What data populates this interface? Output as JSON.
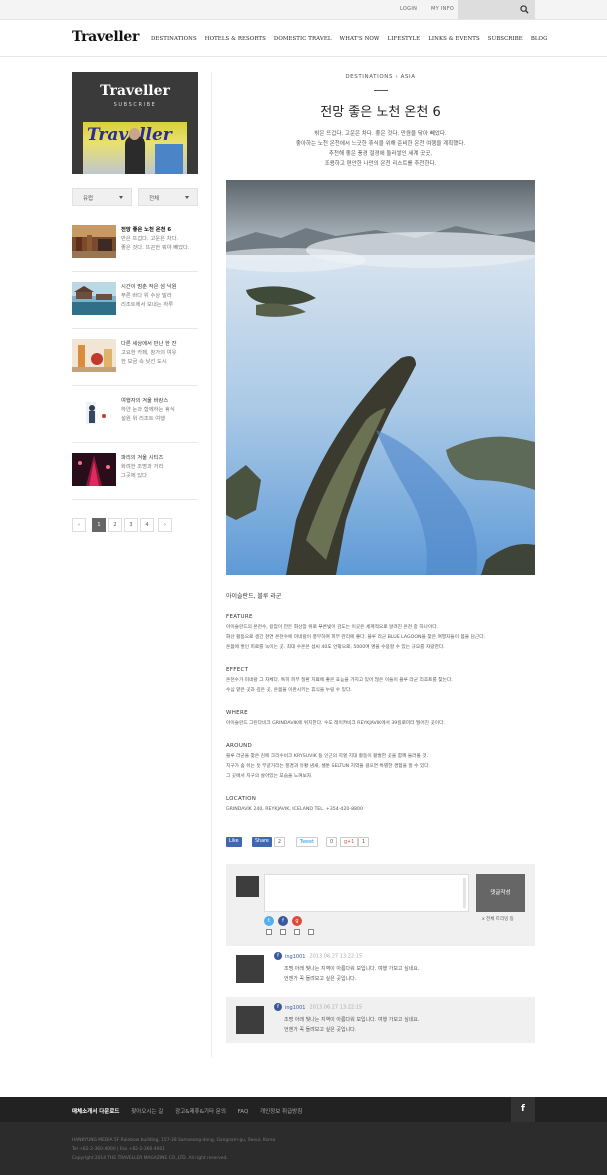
{
  "topbar": {
    "links": [
      "LOGIN",
      "MY INFO"
    ],
    "search_placeholder": ""
  },
  "header": {
    "logo": "Traveller",
    "nav": [
      "DESTINATIONS",
      "HOTELS & RESORTS",
      "DOMESTIC TRAVEL",
      "WHAT'S NOW",
      "LIFESTYLE",
      "LINKS & EVENTS",
      "SUBSCRIBE",
      "BLOG"
    ]
  },
  "sidebar": {
    "subscribe_title": "Traveller",
    "subscribe_sub": "SUBSCRIBE",
    "cover_title": "Traveller",
    "filters": [
      "유럽",
      "전체"
    ],
    "items": [
      {
        "title": "전망 좋은 노천 온천 6",
        "lines": [
          "반은 뜨겁다. 고운은 차다.",
          "좋은 것다. 뜨끈한 뭐야 빼었다."
        ]
      },
      {
        "title": "시간이 멈춘 작은 섬 낙원",
        "lines": [
          "푸른 바다 위 수상 빌라",
          "리조트에서 보내는 하루"
        ]
      },
      {
        "title": "다른 세상에서 만난 한 잔",
        "lines": [
          "고요한 카페, 창가의 여유",
          "한 모금 속 낯선 도시"
        ]
      },
      {
        "title": "여행자의 겨울 바캉스",
        "lines": [
          "하얀 눈과 함께하는 휴식",
          "설원 위 리조트 여행"
        ]
      },
      {
        "title": "파리의 겨울 시티즈",
        "lines": [
          "화려한 조명과 거리",
          "그곳에 있다"
        ]
      }
    ],
    "pages": [
      "‹",
      "1",
      "2",
      "3",
      "4",
      "›"
    ]
  },
  "article": {
    "category": "DESTINATIONS › ASIA",
    "title": "전망 좋은 노천 온천 6",
    "lead": [
      "밖은 뜨겁다. 고운은 차다. 좋은 것다. 만큼을 닦아 빼었다.",
      "좋아하는 노천 온천에서 느긋한 휴식을 위해 준비한 온천 여행을 계획했다.",
      "추천해 좋은 풍경 절경에 둘러쌓인 세계 곳곳,",
      "조용하고 편안한 나만의 온천 리스트를 추천한다."
    ],
    "caption": "아이슬란드, 블루 라군",
    "sections": [
      {
        "heading": "FEATURE",
        "lines": [
          "아이슬란드의 온천수, 용암이 만든 화산암 위로 푸른빛이 감도는 이곳은 세계적으로 알려진 온천 중 하나이다.",
          "화산 활동으로 생긴 천연 온천수에 미네랄이 풍부하여 피부 관리에 좋다. 블루 라군 BLUE LAGOON을 찾은 여행자들이 몸을 담근다.",
          "온몸에 쌓인 피로를 녹이는 곳. 최대 수온은 섭씨 40도 안팎으로, 5000여 명을 수용할 수 있는 규모를 자랑한다."
        ]
      },
      {
        "heading": "EFFECT",
        "lines": [
          "온천수가 미네랄 그 자체다. 특히 피부 질환 치료에 좋은 효능을 가지고 있어 많은 이들이 블루 라군 리조트를 찾는다.",
          "수심 얕은 곳과 깊은 곳, 온몸을 이완시키는 휴식을 누릴 수 있다."
        ]
      },
      {
        "heading": "WHERE",
        "lines": [
          "아이슬란드 그린다비크 GRINDAVIK에 위치한다. 수도 레이캬비크 REYKJAVIK에서 39킬로미터 떨어진 곳이다."
        ]
      },
      {
        "heading": "AROUND",
        "lines": [
          "블루 라군을 찾은 김에 크리수비크 KRYSUVIK 등 인근의 지열 지대 활동이 활발한 곳을 함께 둘러볼 것.",
          "지구가 숨 쉬는 듯 부글거리는 풍경과 유황 냄새, 셀툰 SELTUN 지역을 걸으면 특별한 경험을 할 수 있다.",
          "그 곳에서 지구의 살아있는 모습을 느껴보자."
        ]
      },
      {
        "heading": "LOCATION",
        "lines": [
          "GRINDAVIK 240, REYKJAVIK, ICELAND TEL. +354-420-8800"
        ]
      }
    ],
    "social": {
      "fb_like": "Like",
      "fb_share": "Share",
      "fb_count": "2",
      "tweet": "Tweet",
      "tweet_count": "0",
      "gplus": "g+1",
      "gplus_count": "1"
    }
  },
  "comments": {
    "submit_label": "댓글작성",
    "option_label": "x 전체 트리밍 등",
    "items": [
      {
        "user": "ing1001",
        "date": "2013.06.27 13:22:15",
        "lines": [
          "조명 아래 빛나는 지역이 아름다워 보입니다. 여행 가보고 싶네요.",
          "언젠가 꼭 들려보고 싶은 곳입니다."
        ]
      },
      {
        "user": "ing1001",
        "date": "2013.06.27 13:22:15",
        "lines": [
          "조명 아래 빛나는 지역이 아름다워 보입니다. 여행 가보고 싶네요.",
          "언젠가 꼭 들려보고 싶은 곳입니다."
        ]
      }
    ]
  },
  "footer": {
    "links": [
      "매체소개서 다운로드",
      "찾아오시는 길",
      "광고&제휴&기타 문의",
      "FAQ",
      "개인정보 취급방침"
    ],
    "fb": "f",
    "info": [
      "HANKYUNG MEDIA 5F Rainbow building, 157-28 Samseong-dong, Gangnam-gu, Seoul, Korea",
      "Tel +82-2-360-4000 | Fax +82-2-360-4001",
      "Copyright 2014 THE TRAVELLER MAGAZINE CO.,LTD. All right reserved."
    ]
  },
  "colors": {
    "facebook": "#3b5998",
    "twitter": "#55acee",
    "gplus": "#dd4b39",
    "dark": "#3d3d3d"
  }
}
